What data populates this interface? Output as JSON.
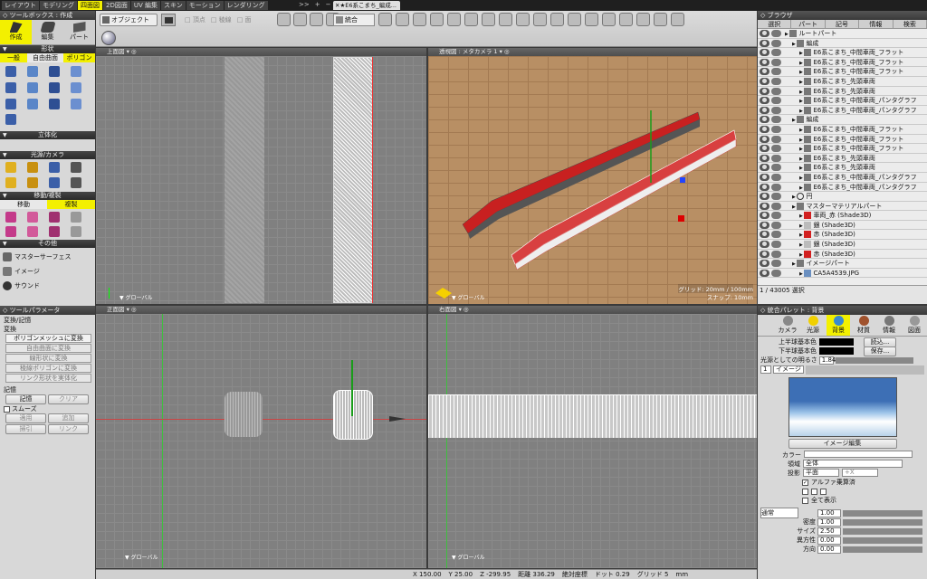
{
  "menu_tabs": [
    "レイアウト",
    "モデリング",
    "四面図",
    "2D図面",
    "UV 編集",
    "スキン",
    "モーション",
    "レンダリング"
  ],
  "active_tab": "四面図",
  "doc_tab": "★E6系こまち_編成...",
  "doc_tab_extra": [
    ">>",
    "+",
    "−"
  ],
  "left": {
    "toolbox_title": "ツールボックス : 作成",
    "modes": [
      "作成",
      "編集",
      "パート"
    ],
    "shape_title": "形状",
    "shape_tabs": [
      "一般",
      "自由曲面",
      "ポリゴン"
    ],
    "solid_title": "立体化",
    "light_title": "光源/カメラ",
    "move_title": "移動/複製",
    "move_tabs": [
      "移動",
      "複製"
    ],
    "other_title": "その他",
    "other_items": [
      "マスターサーフェス",
      "イメージ",
      "サウンド"
    ],
    "param_title": "ツールパラメータ",
    "transform_section": "変換/記憶",
    "transform_title": "変換",
    "transform_buttons": [
      "ポリゴンメッシュに変換",
      "自由曲面に変換",
      "線形状に変換",
      "稜線ポリゴンに変換",
      "リンク形状を実体化"
    ],
    "memory_title": "記憶",
    "memory_buttons": [
      "記憶",
      "クリア"
    ],
    "smooth_label": "スムーズ",
    "apply_buttons": [
      "適用",
      "追加"
    ],
    "pull_buttons": [
      "掃引",
      "リンク"
    ]
  },
  "top_toolbar": {
    "object_label": "オブジェクト",
    "point_labels": [
      "頂点",
      "稜線",
      "面"
    ],
    "merge_label": "統合"
  },
  "viewports": {
    "top": {
      "title": "上面図",
      "global": "グローバル"
    },
    "persp": {
      "title": "透視図 : メタカメラ 1",
      "global": "グローバル",
      "grid": "グリッド: 20mm / 100mm",
      "snap": "スナップ: 10mm"
    },
    "front": {
      "title": "正面図",
      "global": "グローバル"
    },
    "right": {
      "title": "右面図",
      "global": "グローバル"
    }
  },
  "status": {
    "x_label": "X",
    "x": "150.00",
    "y_label": "Y",
    "y": "25.00",
    "z_label": "Z",
    "z": "-299.95",
    "dist_label": "距離",
    "dist": "336.29",
    "abs_label": "絶対座標",
    "dot_label": "ドット",
    "dot": "0.29",
    "grid_label": "グリッド",
    "grid": "5",
    "unit": "mm"
  },
  "browser": {
    "title": "ブラウザ",
    "tabs": [
      "選択",
      "パート",
      "記号",
      "情報",
      "検索"
    ],
    "selection": "1 / 43005 選択",
    "rows": [
      {
        "indent": 0,
        "label": "ルートパート",
        "type": "part",
        "color": "#777"
      },
      {
        "indent": 1,
        "label": "編成",
        "type": "part",
        "color": "#777"
      },
      {
        "indent": 2,
        "label": "E6系こまち_中間車両_フラット",
        "type": "part",
        "color": "#777"
      },
      {
        "indent": 2,
        "label": "E6系こまち_中間車両_フラット",
        "type": "part",
        "color": "#777"
      },
      {
        "indent": 2,
        "label": "E6系こまち_中間車両_フラット",
        "type": "part",
        "color": "#777"
      },
      {
        "indent": 2,
        "label": "E6系こまち_先頭車両",
        "type": "part",
        "color": "#777"
      },
      {
        "indent": 2,
        "label": "E6系こまち_先頭車両",
        "type": "part",
        "color": "#777"
      },
      {
        "indent": 2,
        "label": "E6系こまち_中間車両_パンタグラフ",
        "type": "part",
        "color": "#777"
      },
      {
        "indent": 2,
        "label": "E6系こまち_中間車両_パンタグラフ",
        "type": "part",
        "color": "#777"
      },
      {
        "indent": 1,
        "label": "編成",
        "type": "part",
        "color": "#777"
      },
      {
        "indent": 2,
        "label": "E6系こまち_中間車両_フラット",
        "type": "part",
        "color": "#777"
      },
      {
        "indent": 2,
        "label": "E6系こまち_中間車両_フラット",
        "type": "part",
        "color": "#777"
      },
      {
        "indent": 2,
        "label": "E6系こまち_中間車両_フラット",
        "type": "part",
        "color": "#777"
      },
      {
        "indent": 2,
        "label": "E6系こまち_先頭車両",
        "type": "part",
        "color": "#777"
      },
      {
        "indent": 2,
        "label": "E6系こまち_先頭車両",
        "type": "part",
        "color": "#777"
      },
      {
        "indent": 2,
        "label": "E6系こまち_中間車両_パンタグラフ",
        "type": "part",
        "color": "#777"
      },
      {
        "indent": 2,
        "label": "E6系こまち_中間車両_パンタグラフ",
        "type": "part",
        "color": "#777"
      },
      {
        "indent": 1,
        "label": "円",
        "type": "circle",
        "color": "#333"
      },
      {
        "indent": 1,
        "label": "マスターマテリアルパート",
        "type": "part",
        "color": "#777"
      },
      {
        "indent": 2,
        "label": "車両_赤 (Shade3D)",
        "type": "mat",
        "color": "#d22020"
      },
      {
        "indent": 2,
        "label": "銀 (Shade3D)",
        "type": "mat",
        "color": "#bbbbbb"
      },
      {
        "indent": 2,
        "label": "赤 (Shade3D)",
        "type": "mat",
        "color": "#d22020"
      },
      {
        "indent": 2,
        "label": "銀 (Shade3D)",
        "type": "mat",
        "color": "#bbbbbb"
      },
      {
        "indent": 2,
        "label": "赤 (Shade3D)",
        "type": "mat",
        "color": "#d22020"
      },
      {
        "indent": 1,
        "label": "イメージパート",
        "type": "part",
        "color": "#777"
      },
      {
        "indent": 2,
        "label": "CA5A4539.JPG",
        "type": "img",
        "color": "#6a8fc0"
      }
    ]
  },
  "palette": {
    "title": "統合パレット : 背景",
    "tabs": [
      "カメラ",
      "光源",
      "背景",
      "材質",
      "情報",
      "図面"
    ],
    "active": "背景",
    "upper_label": "上半球基本色",
    "lower_label": "下半球基本色",
    "load_button": "読込...",
    "save_button": "保存...",
    "brightness_label": "光源としての明るさ",
    "brightness": "1.84",
    "layer_num": "1",
    "layer_type": "イメージ",
    "image_edit": "イメージ編集",
    "color_label": "カラー",
    "region_label": "領域",
    "region_value": "全体",
    "projection_label": "投影",
    "projection_value": "平面",
    "projection_axis": "+X",
    "alpha_label": "アルファ乗算済",
    "show_all_label": "全て表示",
    "blend_mode": "通常",
    "blend_value": "1.00",
    "density_label": "密度",
    "density_value": "1.00",
    "size_label": "サイズ",
    "size_value": "2.50",
    "aniso_label": "異方性",
    "aniso_value": "0.00",
    "dir_label": "方向",
    "dir_value": "0.00"
  }
}
